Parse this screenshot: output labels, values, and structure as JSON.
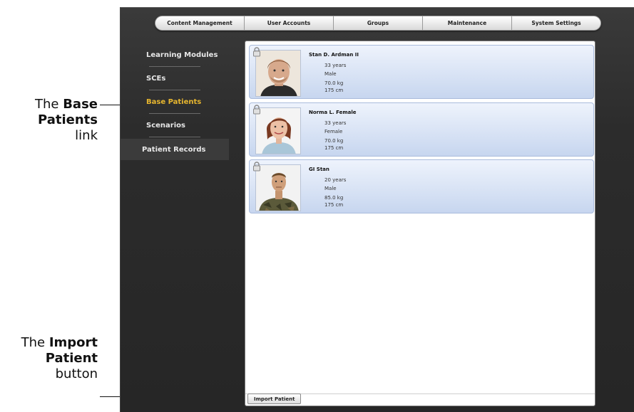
{
  "callouts": {
    "base_patients": {
      "prefix": "The ",
      "bold1": "Base",
      "bold2": "Patients",
      "suffix": "link"
    },
    "import_patient": {
      "prefix": "The ",
      "bold1": "Import",
      "bold2": "Patient",
      "suffix": "button"
    }
  },
  "topnav": {
    "items": [
      "Content Management",
      "User Accounts",
      "Groups",
      "Maintenance",
      "System Settings"
    ]
  },
  "sidebar": {
    "items": [
      "Learning Modules",
      "SCEs",
      "Base Patients",
      "Scenarios",
      "Patient Records"
    ],
    "active": "Base Patients"
  },
  "patients": [
    {
      "name": "Stan D. Ardman II",
      "age": "33 years",
      "sex": "Male",
      "weight": "70.0 kg",
      "height": "175 cm"
    },
    {
      "name": "Norma L. Female",
      "age": "33 years",
      "sex": "Female",
      "weight": "70.0 kg",
      "height": "175 cm"
    },
    {
      "name": "GI Stan",
      "age": "20 years",
      "sex": "Male",
      "weight": "85.0 kg",
      "height": "175 cm"
    }
  ],
  "actions": {
    "import_label": "Import Patient"
  },
  "colors": {
    "active_nav": "#e7b62f",
    "card_top": "#eef3fc",
    "card_bottom": "#c7d6ef",
    "app_bg": "#2c2c2c"
  },
  "icons": {
    "card_lock": "lock-icon"
  }
}
